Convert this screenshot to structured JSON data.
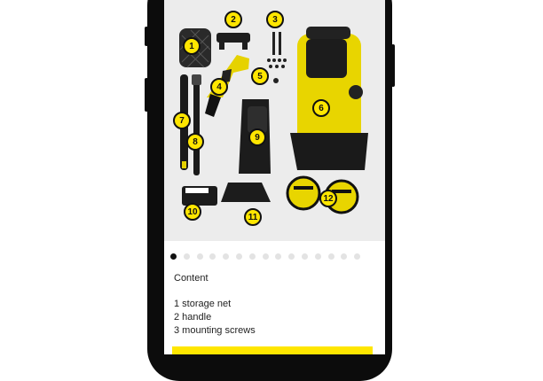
{
  "product_image": {
    "alt": "Pressure washer parts laid out",
    "callouts": [
      "1",
      "2",
      "3",
      "4",
      "5",
      "6",
      "7",
      "8",
      "9",
      "10",
      "11",
      "12"
    ]
  },
  "carousel": {
    "slide_count": 15,
    "active_index": 0
  },
  "content": {
    "title": "Content",
    "items": [
      "1 storage net",
      "2 handle",
      "3 mounting screws"
    ]
  },
  "colors": {
    "brand_yellow": "#ffe600",
    "phone_frame": "#0c0c0c",
    "image_bg": "#ececec"
  }
}
